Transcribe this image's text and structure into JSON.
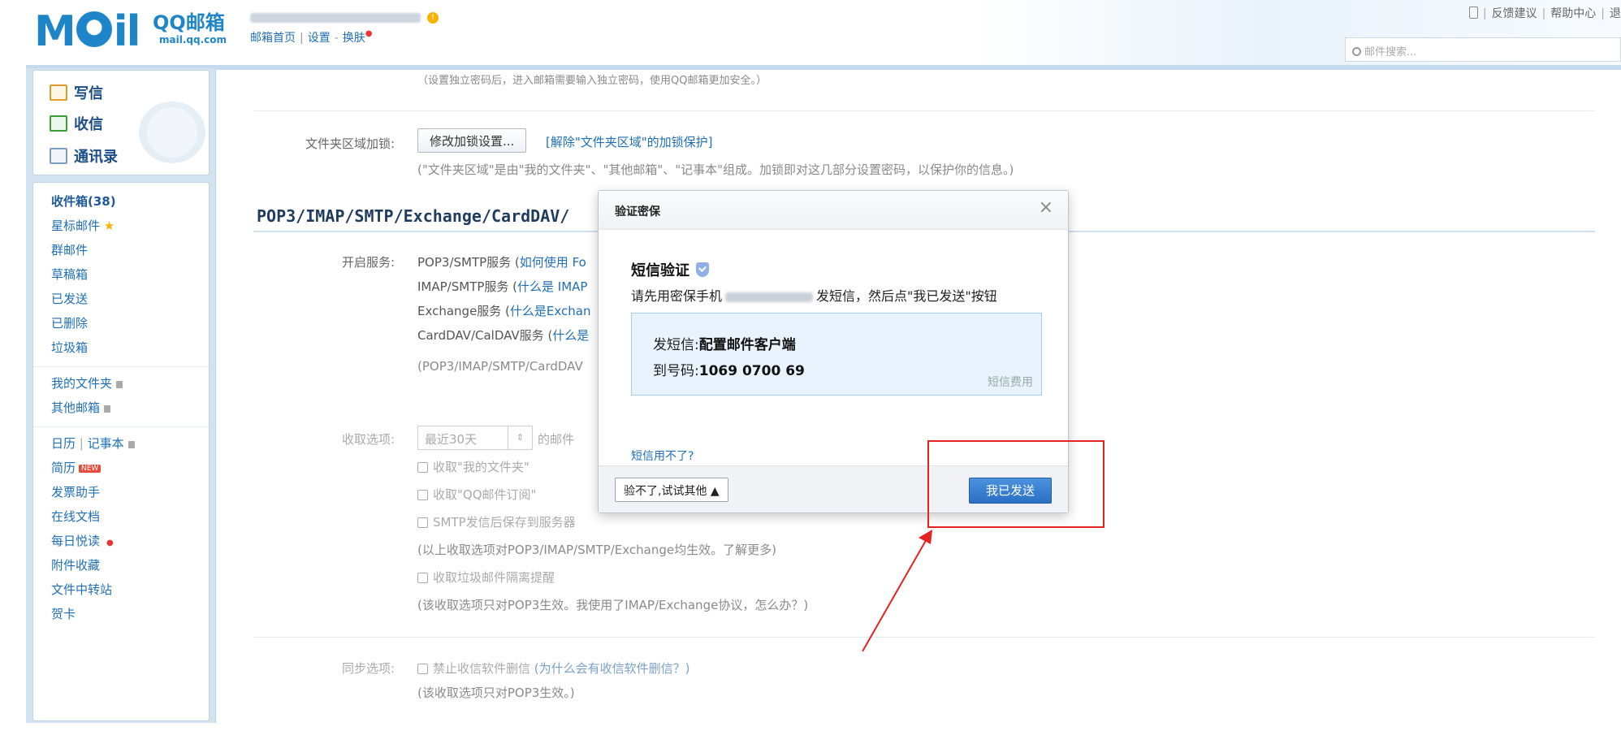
{
  "header": {
    "logo_text": "MOil",
    "brand_cn": "QQ邮箱",
    "brand_en": "mail.qq.com",
    "nav": {
      "home": "邮箱首页",
      "settings": "设置",
      "skin": "换肤"
    },
    "top_links": {
      "feedback": "反馈建议",
      "help": "帮助中心",
      "more": "退"
    },
    "search_placeholder": "邮件搜索..."
  },
  "sidebar": {
    "compose": "写信",
    "receive": "收信",
    "contacts": "通讯录",
    "items": [
      {
        "label": "收件箱(38)"
      },
      {
        "label": "星标邮件"
      },
      {
        "label": "群邮件"
      },
      {
        "label": "草稿箱"
      },
      {
        "label": "已发送"
      },
      {
        "label": "已删除"
      },
      {
        "label": "垃圾箱"
      },
      {
        "label": "我的文件夹"
      },
      {
        "label": "其他邮箱"
      },
      {
        "label": "日历"
      },
      {
        "label": "记事本"
      },
      {
        "label": "简历"
      },
      {
        "label": "发票助手"
      },
      {
        "label": "在线文档"
      },
      {
        "label": "每日悦读"
      },
      {
        "label": "附件收藏"
      },
      {
        "label": "文件中转站"
      },
      {
        "label": "贺卡"
      }
    ],
    "new_badge": "NEW"
  },
  "main": {
    "top_note": "（设置独立密码后，进入邮箱需要输入独立密码，使用QQ邮箱更加安全。）",
    "folder_label": "文件夹区域加锁:",
    "folder_button": "修改加锁设置...",
    "folder_unlock_link": "[解除\"文件夹区域\"的加锁保护]",
    "folder_note": "(\"文件夹区域\"是由\"我的文件夹\"、\"其他邮箱\"、\"记事本\"组成。加锁即对这几部分设置密码，以保护你的信息。)",
    "section_title": "POP3/IMAP/SMTP/Exchange/CardDAV/",
    "service_label": "开启服务:",
    "services": [
      {
        "text": "POP3/SMTP服务 (",
        "link": "如何使用 Fo"
      },
      {
        "text": "IMAP/SMTP服务 (",
        "link": "什么是 IMAP"
      },
      {
        "text": "Exchange服务 (",
        "link": "什么是Exchan"
      },
      {
        "text": "CardDAV/CalDAV服务 (",
        "link": "什么是"
      }
    ],
    "service_note": "(POP3/IMAP/SMTP/CardDAV",
    "receive_label": "收取选项:",
    "receive_select": "最近30天",
    "receive_suffix": "的邮件",
    "receive_options": [
      "收取\"我的文件夹\"",
      "收取\"QQ邮件订阅\"",
      "SMTP发信后保存到服务器"
    ],
    "receive_note1": "(以上收取选项对POP3/IMAP/SMTP/Exchange均生效。了解更多)",
    "receive_option4": "收取垃圾邮件隔离提醒",
    "receive_note2": "(该收取选项只对POP3生效。我使用了IMAP/Exchange协议，怎么办？)",
    "sync_label": "同步选项:",
    "sync_option": "禁止收信软件删信",
    "sync_link": "(为什么会有收信软件删信？)",
    "sync_note": "(该收取选项只对POP3生效。)"
  },
  "dialog": {
    "title": "验证密保",
    "close": "×",
    "heading": "短信验证",
    "instruction_pre": "请先用密保手机",
    "instruction_post": "发短信，然后点\"我已发送\"按钮",
    "sms_label": "发短信:",
    "sms_content": "配置邮件客户端",
    "to_label": "到号码:",
    "to_number": "1069 0700 69",
    "fee": "短信费用",
    "cant_use": "短信用不了?",
    "alt_button": "验不了,试试其他 ▲",
    "sent_button": "我已发送"
  },
  "colors": {
    "brand": "#1e86c8",
    "primary_button": "#2b6fc4",
    "annotation": "#e52222"
  }
}
